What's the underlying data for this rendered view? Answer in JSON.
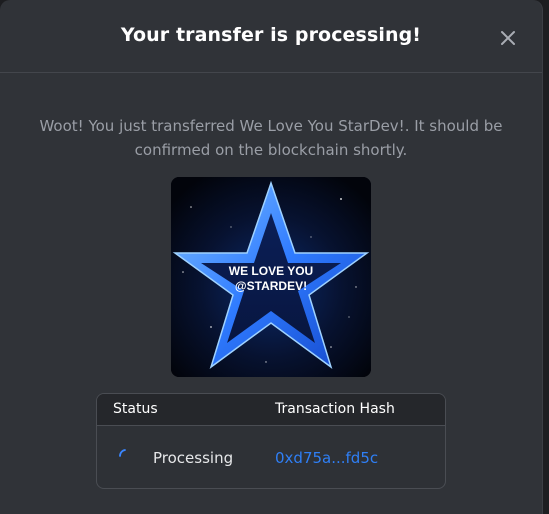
{
  "modal": {
    "title": "Your transfer is processing!",
    "close_icon": "close-icon",
    "message": "Woot! You just transferred We Love You StarDev!. It should be confirmed on the blockchain shortly."
  },
  "nft": {
    "caption_line1": "WE LOVE YOU",
    "caption_line2": "@STARDEV!"
  },
  "transaction": {
    "columns": [
      "Status",
      "Transaction Hash"
    ],
    "status": "Processing",
    "status_icon": "spinner-icon",
    "hash": "0xd75a...fd5c"
  },
  "colors": {
    "modal_bg": "#303338",
    "link": "#2f7ff5",
    "muted_text": "#9a9ea6"
  }
}
